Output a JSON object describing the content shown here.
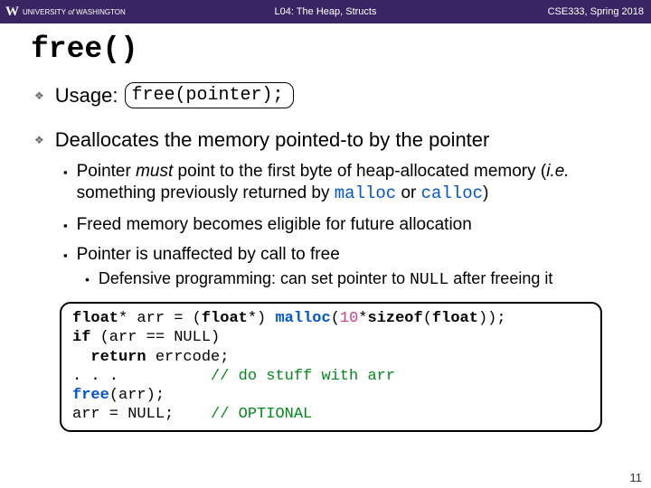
{
  "header": {
    "university_prefix": "UNIVERSITY",
    "university_of": " of ",
    "university_name": "WASHINGTON",
    "lecture": "L04: The Heap, Structs",
    "course": "CSE333, Spring 2018"
  },
  "title": "free()",
  "bullets": {
    "usage_label": "Usage:",
    "usage_code": "free(pointer);",
    "dealloc": "Deallocates the memory pointed-to by the pointer",
    "sub1_a": "Pointer ",
    "sub1_must": "must",
    "sub1_b": " point to the first byte of heap-allocated memory (",
    "sub1_ie": "i.e.",
    "sub1_c": " something previously returned by ",
    "sub1_malloc": "malloc",
    "sub1_or": " or ",
    "sub1_calloc": "calloc",
    "sub1_end": ")",
    "sub2": "Freed memory becomes eligible for future allocation",
    "sub3": "Pointer is unaffected by call to free",
    "dot_a": "Defensive programming: can set pointer to ",
    "dot_null": "NULL",
    "dot_b": " after freeing it"
  },
  "code": {
    "l1_a": "float",
    "l1_b": "* arr = (",
    "l1_c": "float",
    "l1_d": "*) ",
    "l1_malloc": "malloc",
    "l1_e": "(",
    "l1_num": "10",
    "l1_f": "*",
    "l1_sizeof": "sizeof",
    "l1_g": "(",
    "l1_h": "float",
    "l1_i": "));",
    "l2_a": "if",
    "l2_b": " (arr == NULL)",
    "l3_a": "  ",
    "l3_ret": "return",
    "l3_b": " errcode;",
    "l4_a": ". . .          ",
    "l4_comment": "// do stuff with arr",
    "l5_free": "free",
    "l5_b": "(arr);",
    "l6_a": "arr = NULL;    ",
    "l6_comment": "// OPTIONAL"
  },
  "page_number": "11"
}
